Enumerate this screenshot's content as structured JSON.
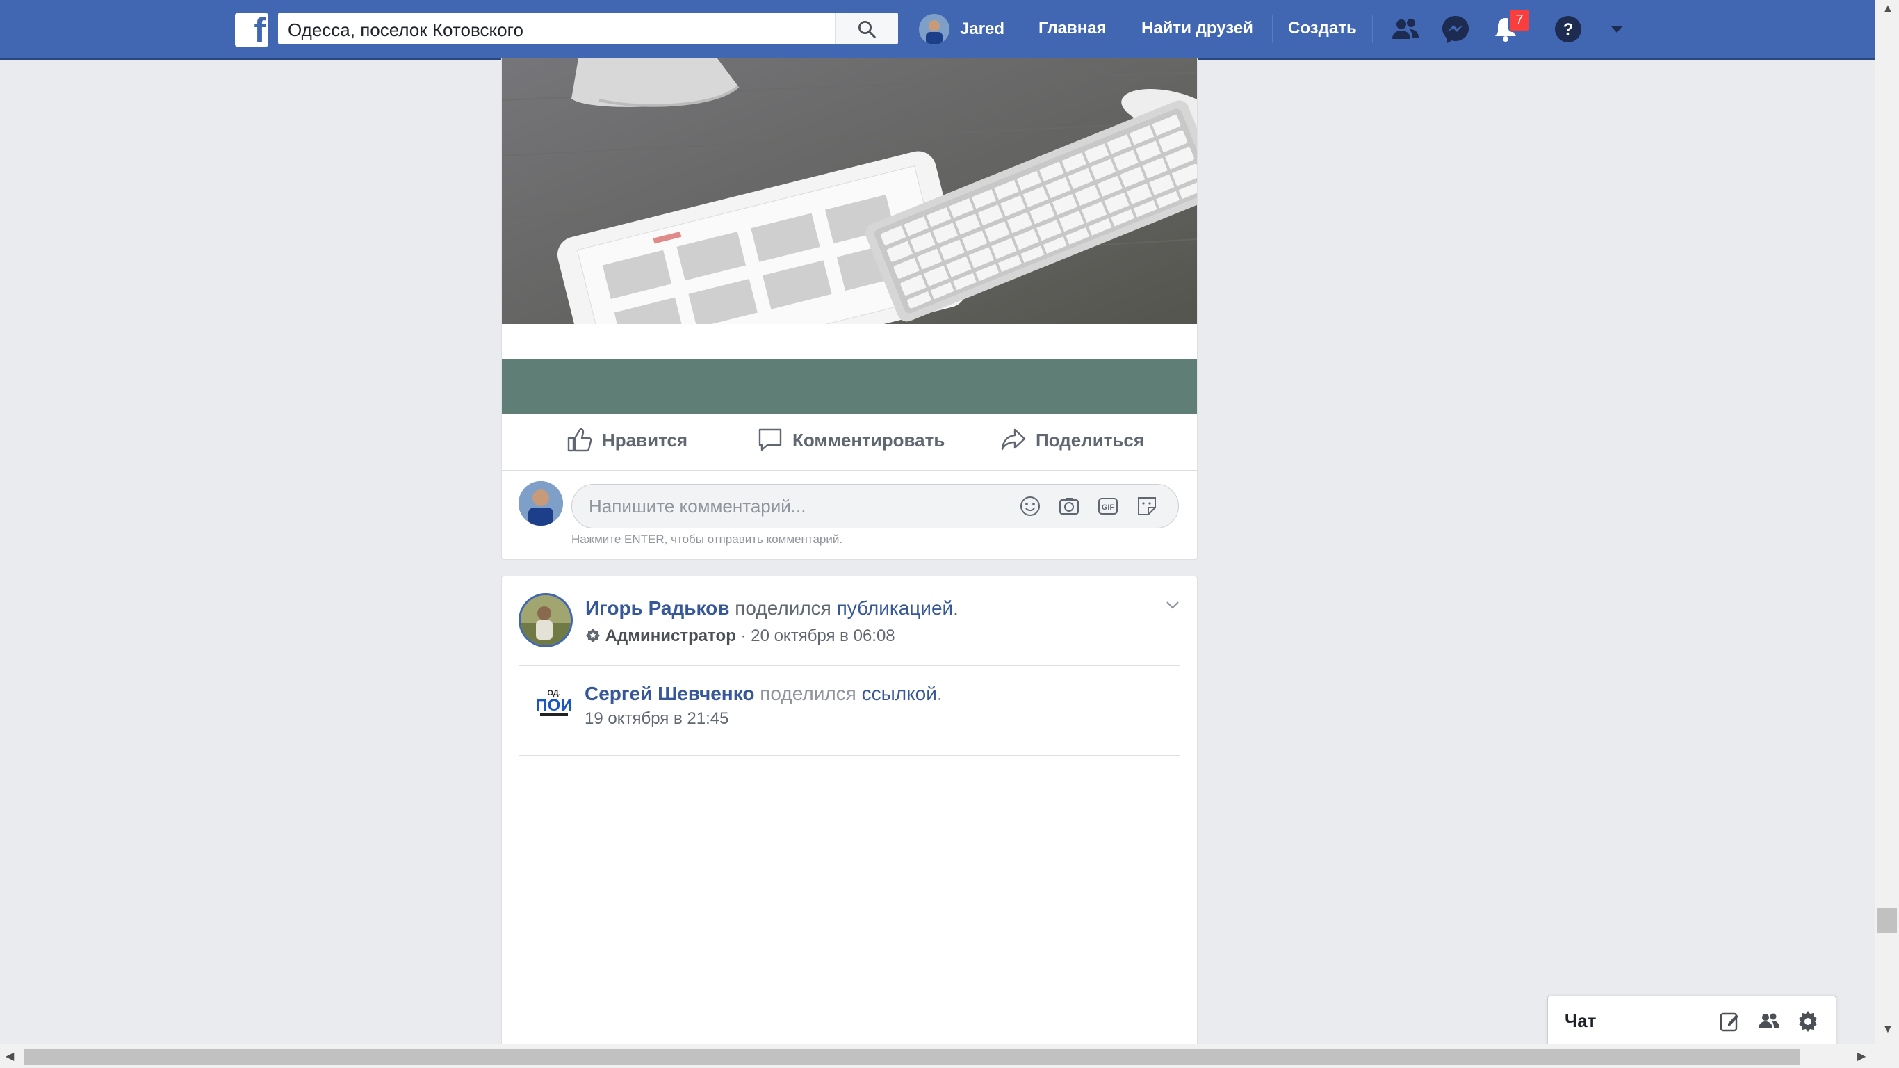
{
  "topbar": {
    "search_value": "Одесса, поселок Котовского",
    "user_name": "Jared",
    "nav": [
      "Главная",
      "Найти друзей",
      "Создать"
    ],
    "notifications_count": "7"
  },
  "post1": {
    "actions": {
      "like": "Нравится",
      "comment": "Комментировать",
      "share": "Поделиться"
    },
    "comment_placeholder": "Напишите комментарий...",
    "comment_hint": "Нажмите ENTER, чтобы отправить комментарий."
  },
  "post2": {
    "author": "Игорь Радьков",
    "action": "поделился",
    "object": "публикацией",
    "period": ".",
    "role": "Администратор",
    "dot": "·",
    "date": "20 октября в 06:08",
    "shared": {
      "author": "Сергей Шевченко",
      "action": "поделился",
      "object": "ссылкой",
      "period": ".",
      "date": "19 октября в 21:45"
    }
  },
  "chat": {
    "label": "Чат"
  },
  "colors": {
    "brand": "#4267b2",
    "teal_band": "#5f7f76",
    "badge": "#fa3e3e"
  }
}
